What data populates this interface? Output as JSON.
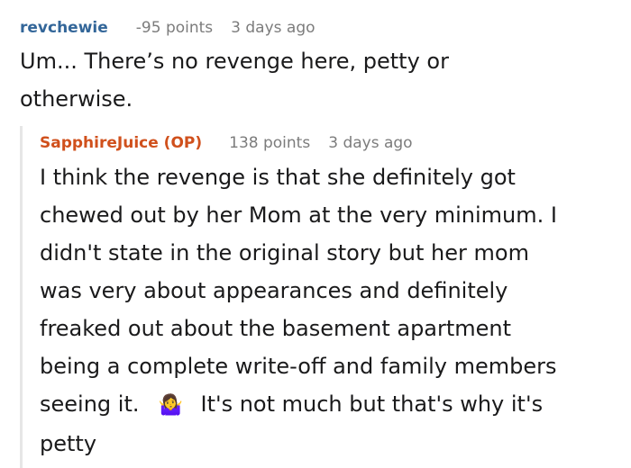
{
  "comment": {
    "author": "revchewie",
    "points": "-95 points",
    "time": "3 days ago",
    "body_lines": [
      "Um... There’s no revenge here, petty or",
      "otherwise."
    ]
  },
  "reply": {
    "author": "SapphireJuice (OP)",
    "points": "138 points",
    "time": "3 days ago",
    "body_lines": [
      "I think the revenge is that she definitely got",
      "chewed out by her Mom at the very minimum. I",
      "didn't state in the original story but her mom",
      "was very about appearances and definitely",
      "freaked out about the basement apartment",
      "being a complete write-off and family members",
      "seeing it."
    ],
    "emoji": "🤷‍♀️",
    "after_emoji": "It's not much but that's why it's",
    "last_line": "petty"
  }
}
